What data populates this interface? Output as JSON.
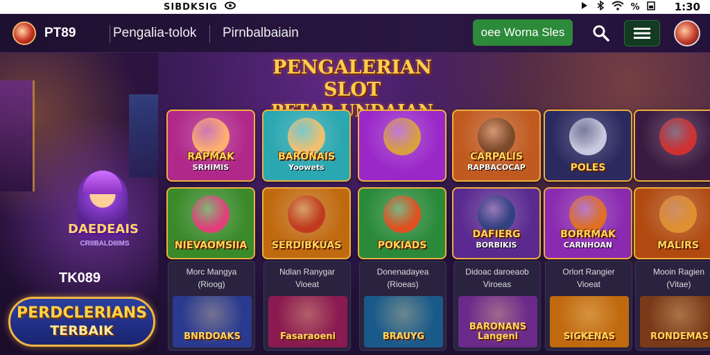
{
  "statusbar": {
    "left_text": "SIBDKSIG",
    "time": "1:30",
    "battery": "%",
    "icons": [
      "eye-icon",
      "bluetooth-icon",
      "wifi-icon",
      "battery-icon"
    ]
  },
  "nav": {
    "brand": "PT89",
    "link1": "Pengalia-tolok",
    "link2": "Pirnbalbaiain",
    "cta": "oee Worna Sles"
  },
  "sidebar": {
    "title": "DAEDEAIS",
    "subtitle": "CRIIBALDIIIMS",
    "code": "TK089",
    "badge_line1": "PERDCLERIANS",
    "badge_line2": "TERBAIK"
  },
  "hero": {
    "line1": "PENGALERIAN SLOT",
    "line2": "PETAR UNDAIAN"
  },
  "games_row1": [
    {
      "title": "RAPMAK",
      "sub": "SRHIMIS",
      "bg": "#b0288a",
      "art": "#ffb070"
    },
    {
      "title": "BARONAIS",
      "sub": "Yoowets",
      "bg": "#2aa7b0",
      "art": "#f0c070"
    },
    {
      "title": "",
      "sub": "",
      "bg": "#9a28c8",
      "art": "#d8a040"
    },
    {
      "title": "CARPALIS",
      "sub": "RAPBACOCAP",
      "bg": "#c05a20",
      "art": "#7a4a2a"
    },
    {
      "title": "POLES",
      "sub": "",
      "bg": "#2a2a60",
      "art": "#c8c8e0"
    },
    {
      "title": "",
      "sub": "",
      "bg": "#3a1a40",
      "art": "#d03030"
    }
  ],
  "games_row2": [
    {
      "title": "NIEVAOMSIIA",
      "sub": "",
      "bg": "#3a8a2a",
      "art": "#e0407a"
    },
    {
      "title": "SERDIBKUAS",
      "sub": "",
      "bg": "#c06a10",
      "art": "#c03a20"
    },
    {
      "title": "POKIADS",
      "sub": "",
      "bg": "#2a8a3a",
      "art": "#e05020"
    },
    {
      "title": "DAFIERG",
      "sub": "BORBIKIS",
      "bg": "#5a2a90",
      "art": "#304080"
    },
    {
      "title": "BORRMAK",
      "sub": "CARNHOAN",
      "bg": "#8a2ab0",
      "art": "#e07020"
    },
    {
      "title": "MALIRS",
      "sub": "",
      "bg": "#b04a10",
      "art": "#e09030"
    }
  ],
  "small_cards": [
    {
      "t1": "Morc Mangya",
      "t2": "(Rioog)",
      "label": "BNRDOAKS",
      "bg": "#2a3a90"
    },
    {
      "t1": "Ndlan Ranygar",
      "t2": "Vioeat",
      "label": "Fasaraoeni",
      "bg": "#8a1a50"
    },
    {
      "t1": "Donenadayea",
      "t2": "(Rioeas)",
      "label": "BRAUYG",
      "bg": "#1a5a8a"
    },
    {
      "t1": "Didoac daroeaob",
      "t2": "Viroeas",
      "label": "BARONANS Langeni",
      "bg": "#6a2a8a"
    },
    {
      "t1": "Orlort Rangier",
      "t2": "Vioeat",
      "label": "SIGKENAS",
      "bg": "#c06a10"
    },
    {
      "t1": "Mooin Ragien",
      "t2": "(Vitae)",
      "label": "RONDEMAS",
      "bg": "#7a3a1a"
    }
  ]
}
